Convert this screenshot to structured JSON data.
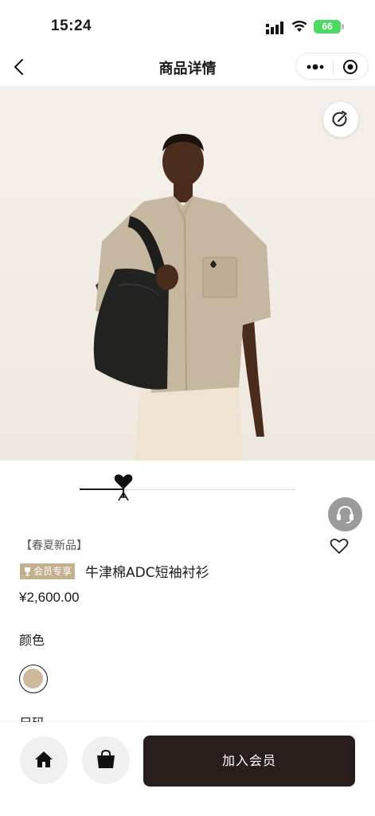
{
  "status_bar": {
    "time": "15:24",
    "battery": "66"
  },
  "nav": {
    "title": "商品详情"
  },
  "product": {
    "tag": "【春夏新品】",
    "member_badge": "会员专享",
    "name": "牛津棉ADC短袖衬衫",
    "price": "¥2,600.00",
    "color_label": "颜色",
    "size_label": "尺码",
    "swatch_color": "#cdb99b",
    "image_index": 1
  },
  "bottom_bar": {
    "join_label": "加入会员"
  },
  "colors": {
    "accent_dark": "#2a1e1c",
    "badge_gold": "#c4b08e",
    "battery_green": "#4cd964"
  },
  "icons": [
    "back-icon",
    "more-icon",
    "target-icon",
    "share-icon",
    "ami-heart-logo",
    "customer-service-icon",
    "heart-icon",
    "home-icon",
    "shopping-bag-icon"
  ]
}
